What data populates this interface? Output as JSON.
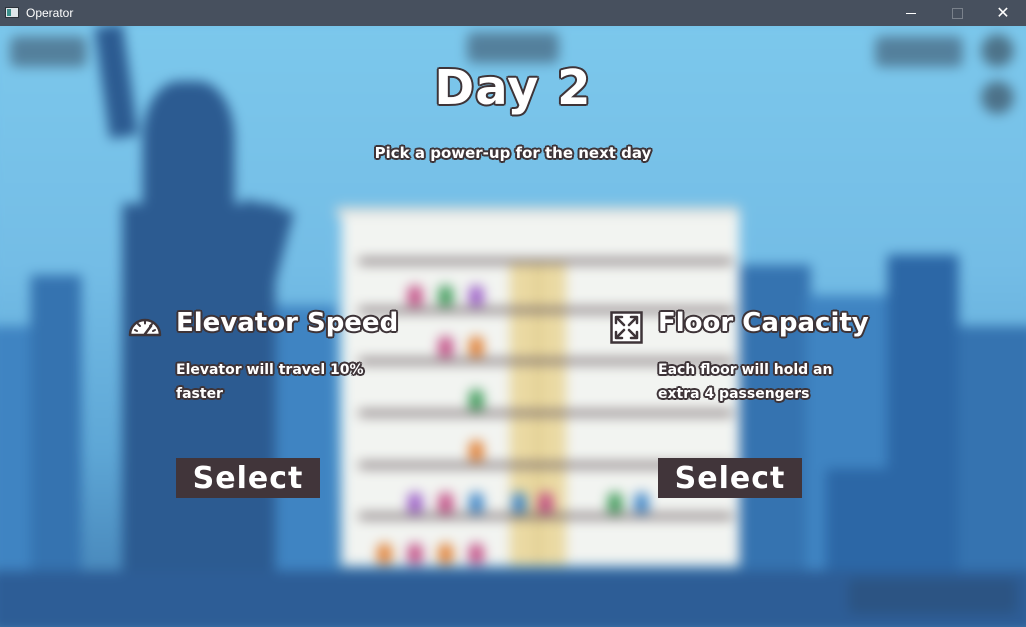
{
  "window": {
    "title": "Operator",
    "controls": {
      "minimize": "minimize-icon",
      "maximize": "maximize-icon",
      "close": "✕"
    }
  },
  "overlay": {
    "title": "Day 2",
    "subtitle": "Pick a power-up for the next day"
  },
  "powerups": [
    {
      "icon": "speedometer-icon",
      "name": "Elevator Speed",
      "description": "Elevator will travel 10% faster",
      "button": "Select"
    },
    {
      "icon": "expand-arrows-icon",
      "name": "Floor Capacity",
      "description": "Each floor will hold an extra 4 passengers",
      "button": "Select"
    }
  ],
  "colors": {
    "button_bg": "#41353a",
    "text_outline": "#3e3438",
    "sky": "#7cc8ec"
  }
}
